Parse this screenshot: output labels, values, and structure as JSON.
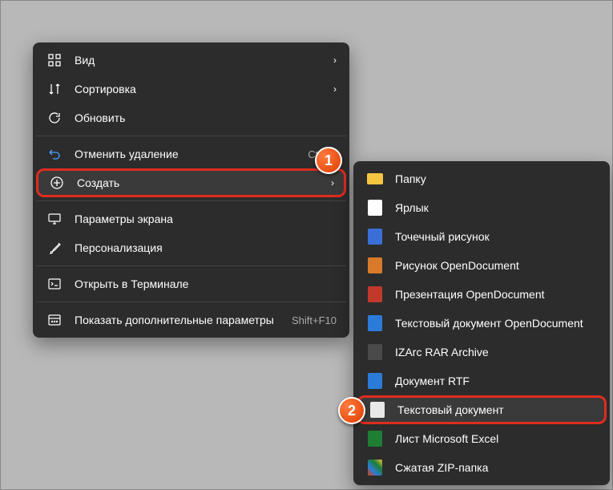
{
  "main_menu": {
    "items": [
      {
        "label": "Вид",
        "icon": "grid-icon",
        "has_submenu": true
      },
      {
        "label": "Сортировка",
        "icon": "sort-icon",
        "has_submenu": true
      },
      {
        "label": "Обновить",
        "icon": "refresh-icon"
      }
    ],
    "group2": [
      {
        "label": "Отменить удаление",
        "icon": "undo-icon",
        "shortcut": "Ctrl+Z"
      },
      {
        "label": "Создать",
        "icon": "plus-circle-icon",
        "has_submenu": true,
        "highlighted": true
      }
    ],
    "group3": [
      {
        "label": "Параметры экрана",
        "icon": "display-icon"
      },
      {
        "label": "Персонализация",
        "icon": "brush-icon"
      }
    ],
    "group4": [
      {
        "label": "Открыть в Терминале",
        "icon": "terminal-icon"
      }
    ],
    "group5": [
      {
        "label": "Показать дополнительные параметры",
        "icon": "more-options-icon",
        "shortcut": "Shift+F10"
      }
    ]
  },
  "sub_menu": {
    "items": [
      {
        "label": "Папку",
        "icon": "folder-icon",
        "cls": "fi-folder"
      },
      {
        "label": "Ярлык",
        "icon": "shortcut-icon",
        "cls": "fi-shortcut"
      },
      {
        "label": "Точечный рисунок",
        "icon": "bmp-icon",
        "cls": "fi-bmp"
      },
      {
        "label": "Рисунок OpenDocument",
        "icon": "odg-icon",
        "cls": "fi-odg"
      },
      {
        "label": "Презентация OpenDocument",
        "icon": "odp-icon",
        "cls": "fi-odp"
      },
      {
        "label": "Текстовый документ OpenDocument",
        "icon": "odt-icon",
        "cls": "fi-odt"
      },
      {
        "label": "IZArc RAR Archive",
        "icon": "rar-icon",
        "cls": "fi-rar"
      },
      {
        "label": "Документ RTF",
        "icon": "rtf-icon",
        "cls": "fi-rtf"
      },
      {
        "label": "Текстовый документ",
        "icon": "txt-icon",
        "cls": "fi-txt",
        "highlighted": true
      },
      {
        "label": "Лист Microsoft Excel",
        "icon": "xls-icon",
        "cls": "fi-xls"
      },
      {
        "label": "Сжатая ZIP-папка",
        "icon": "zip-icon",
        "cls": "fi-zip"
      }
    ]
  },
  "badges": {
    "b1": "1",
    "b2": "2"
  }
}
